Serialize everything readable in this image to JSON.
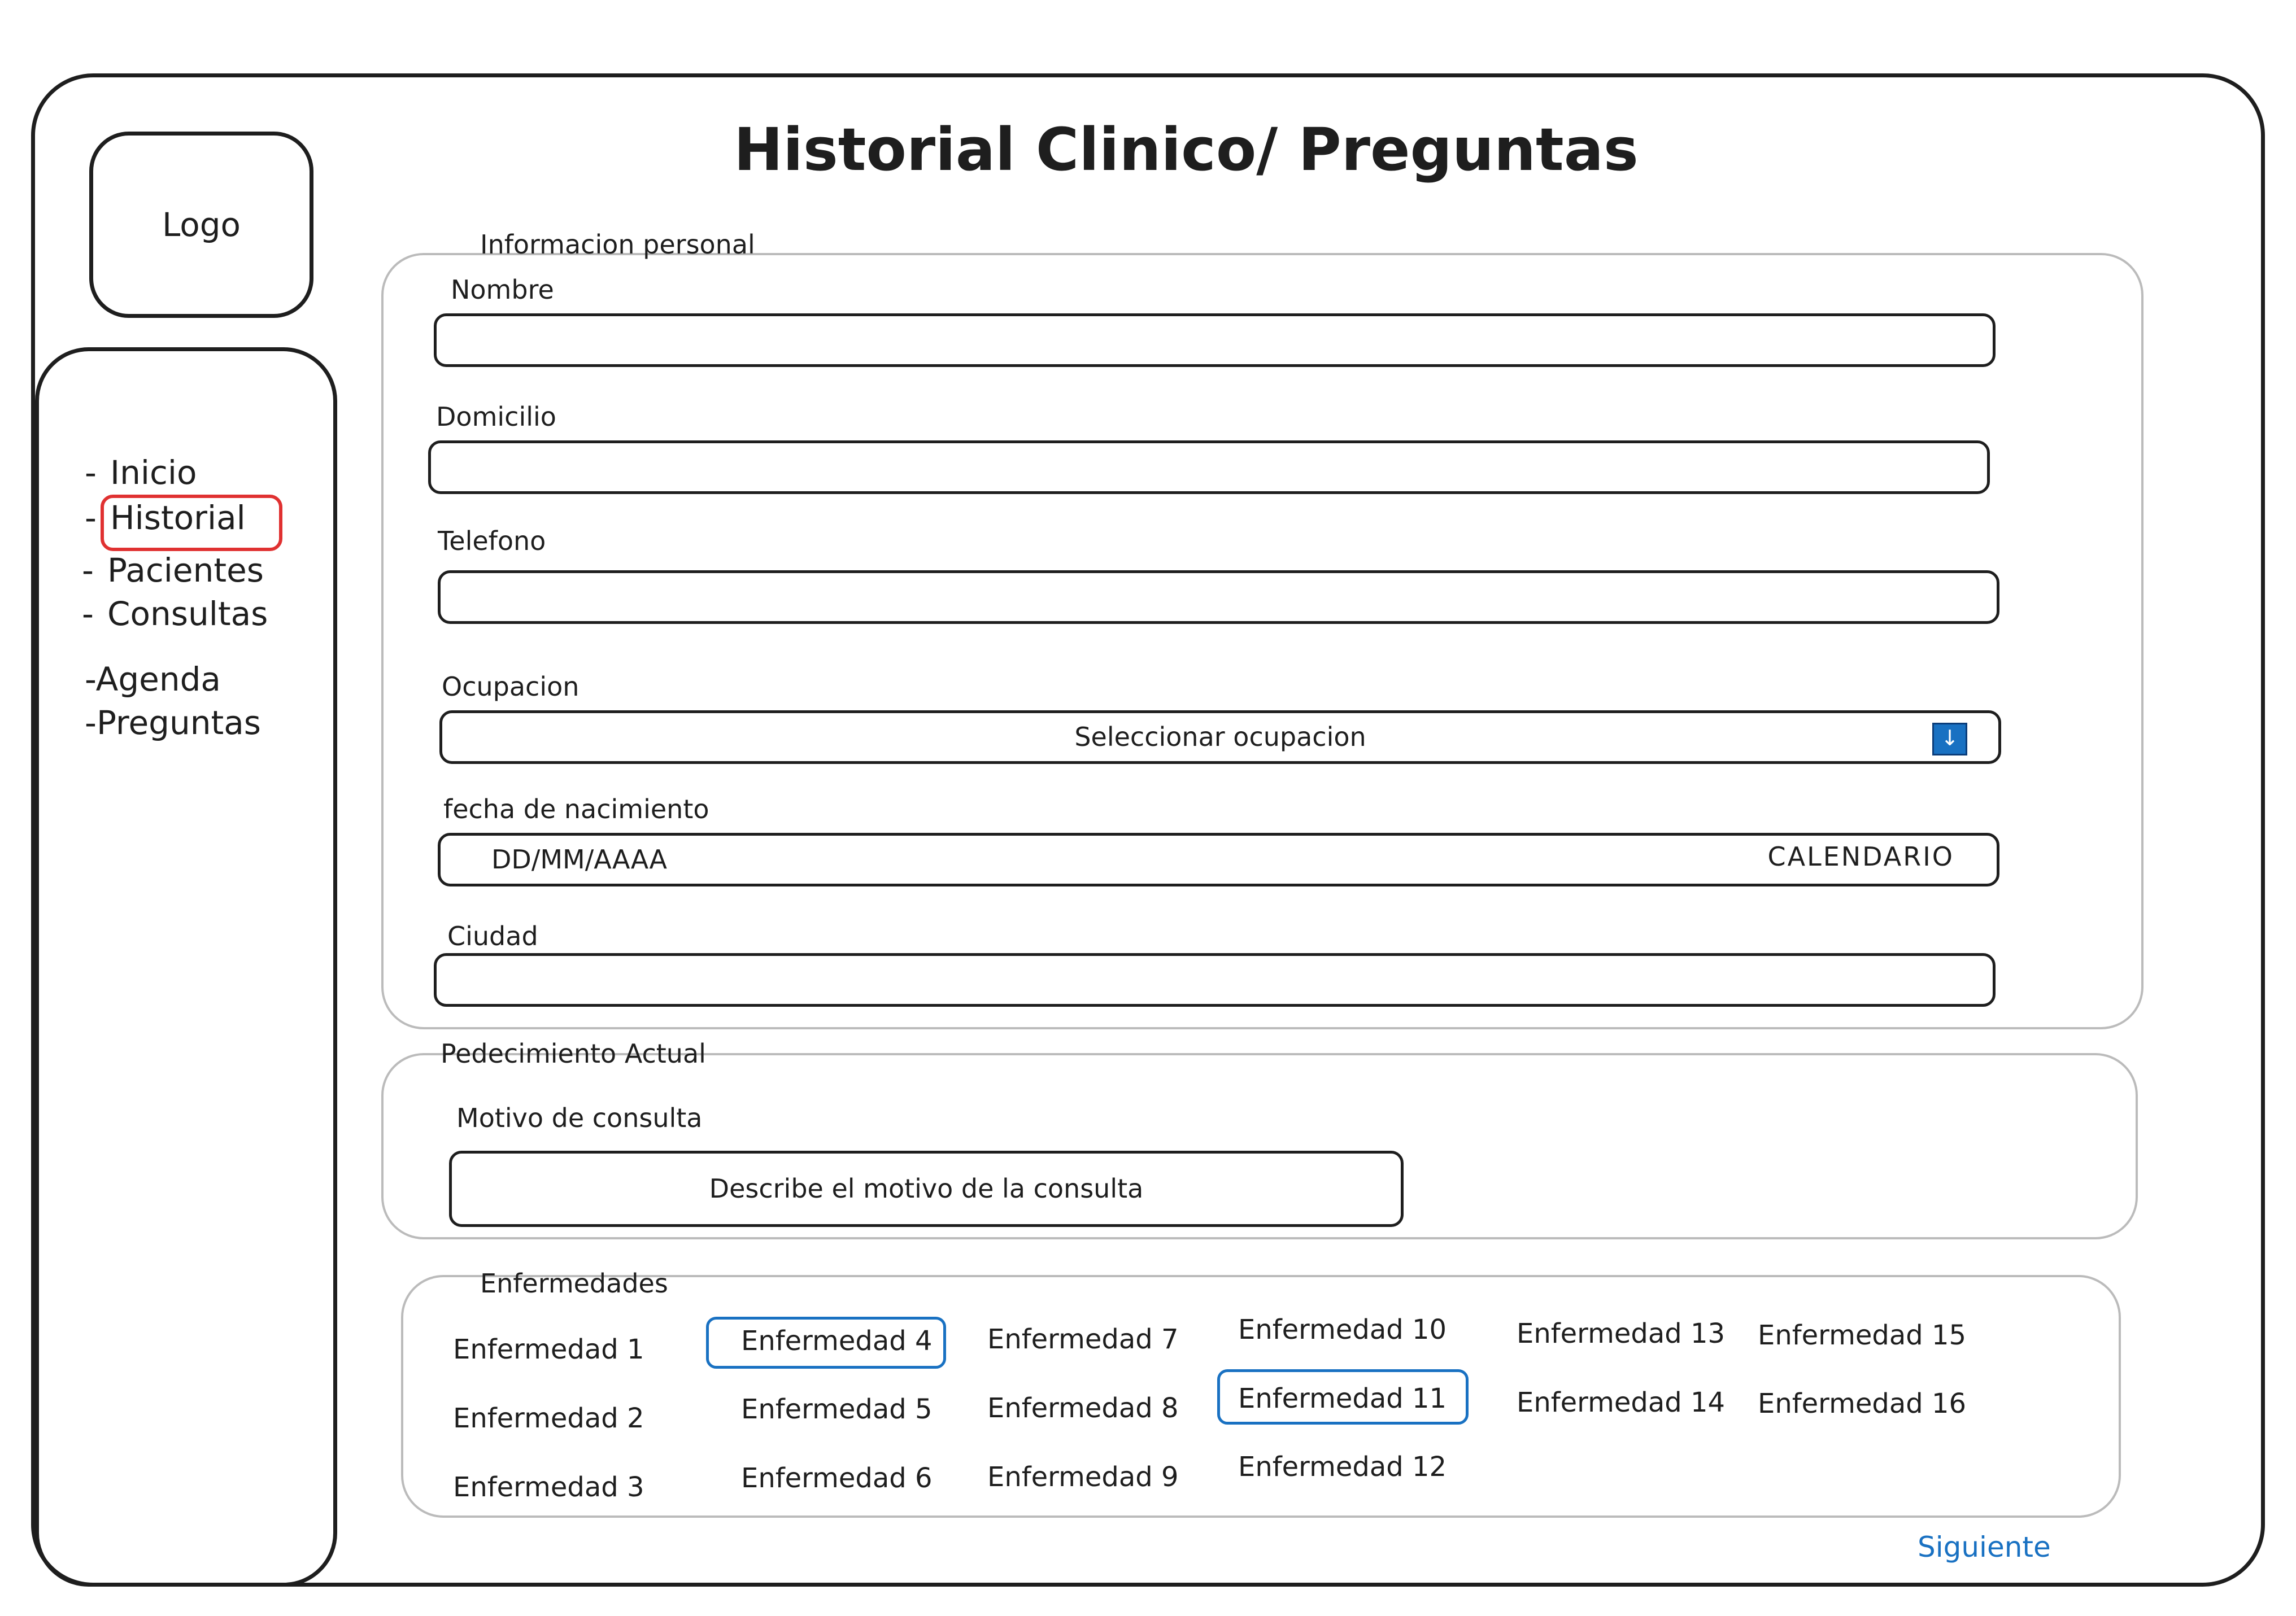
{
  "app": {
    "title": "Historial Clinico/ Preguntas",
    "logo_text": "Logo"
  },
  "sidebar": {
    "items": [
      {
        "prefix": "-",
        "label": "Inicio"
      },
      {
        "prefix": "-",
        "label": "Historial",
        "active": true
      },
      {
        "prefix": "-",
        "label": "Pacientes"
      },
      {
        "prefix": "-",
        "label": "Consultas"
      },
      {
        "prefix": "-",
        "label": "Agenda"
      },
      {
        "prefix": "-",
        "label": "Preguntas"
      }
    ],
    "active_color": "#e03131"
  },
  "personal_info": {
    "legend": "Informacion personal",
    "nombre": {
      "label": "Nombre",
      "value": ""
    },
    "domicilio": {
      "label": "Domicilio",
      "value": ""
    },
    "telefono": {
      "label": "Telefono",
      "value": ""
    },
    "ocupacion": {
      "label": "Ocupacion",
      "selected": "Seleccionar ocupacion",
      "icon": "arrow-down-icon",
      "icon_glyph": "↓"
    },
    "fecha": {
      "label": "fecha de nacimiento",
      "placeholder": "DD/MM/AAAA",
      "calendar": "CALENDARIO"
    },
    "ciudad": {
      "label": "Ciudad",
      "value": ""
    }
  },
  "padecimiento": {
    "legend": "Pedecimiento Actual",
    "motivo": {
      "label": "Motivo de consulta",
      "placeholder": "Describe el motivo de la consulta"
    }
  },
  "enfermedades": {
    "legend": "Enfermedades",
    "items": [
      {
        "label": "Enfermedad 1",
        "selected": false
      },
      {
        "label": "Enfermedad 2",
        "selected": false
      },
      {
        "label": "Enfermedad 3",
        "selected": false
      },
      {
        "label": "Enfermedad 4",
        "selected": true
      },
      {
        "label": "Enfermedad 5",
        "selected": false
      },
      {
        "label": "Enfermedad 6",
        "selected": false
      },
      {
        "label": "Enfermedad 7",
        "selected": false
      },
      {
        "label": "Enfermedad 8",
        "selected": false
      },
      {
        "label": "Enfermedad 9",
        "selected": false
      },
      {
        "label": "Enfermedad 10",
        "selected": false
      },
      {
        "label": "Enfermedad 11",
        "selected": true
      },
      {
        "label": "Enfermedad 12",
        "selected": false
      },
      {
        "label": "Enfermedad 13",
        "selected": false
      },
      {
        "label": "Enfermedad 14",
        "selected": false
      },
      {
        "label": "Enfermedad 15",
        "selected": false
      },
      {
        "label": "Enfermedad 16",
        "selected": false
      }
    ],
    "selected_color": "#1971c2"
  },
  "footer": {
    "next_label": "Siguiente",
    "link_color": "#1971c2"
  }
}
